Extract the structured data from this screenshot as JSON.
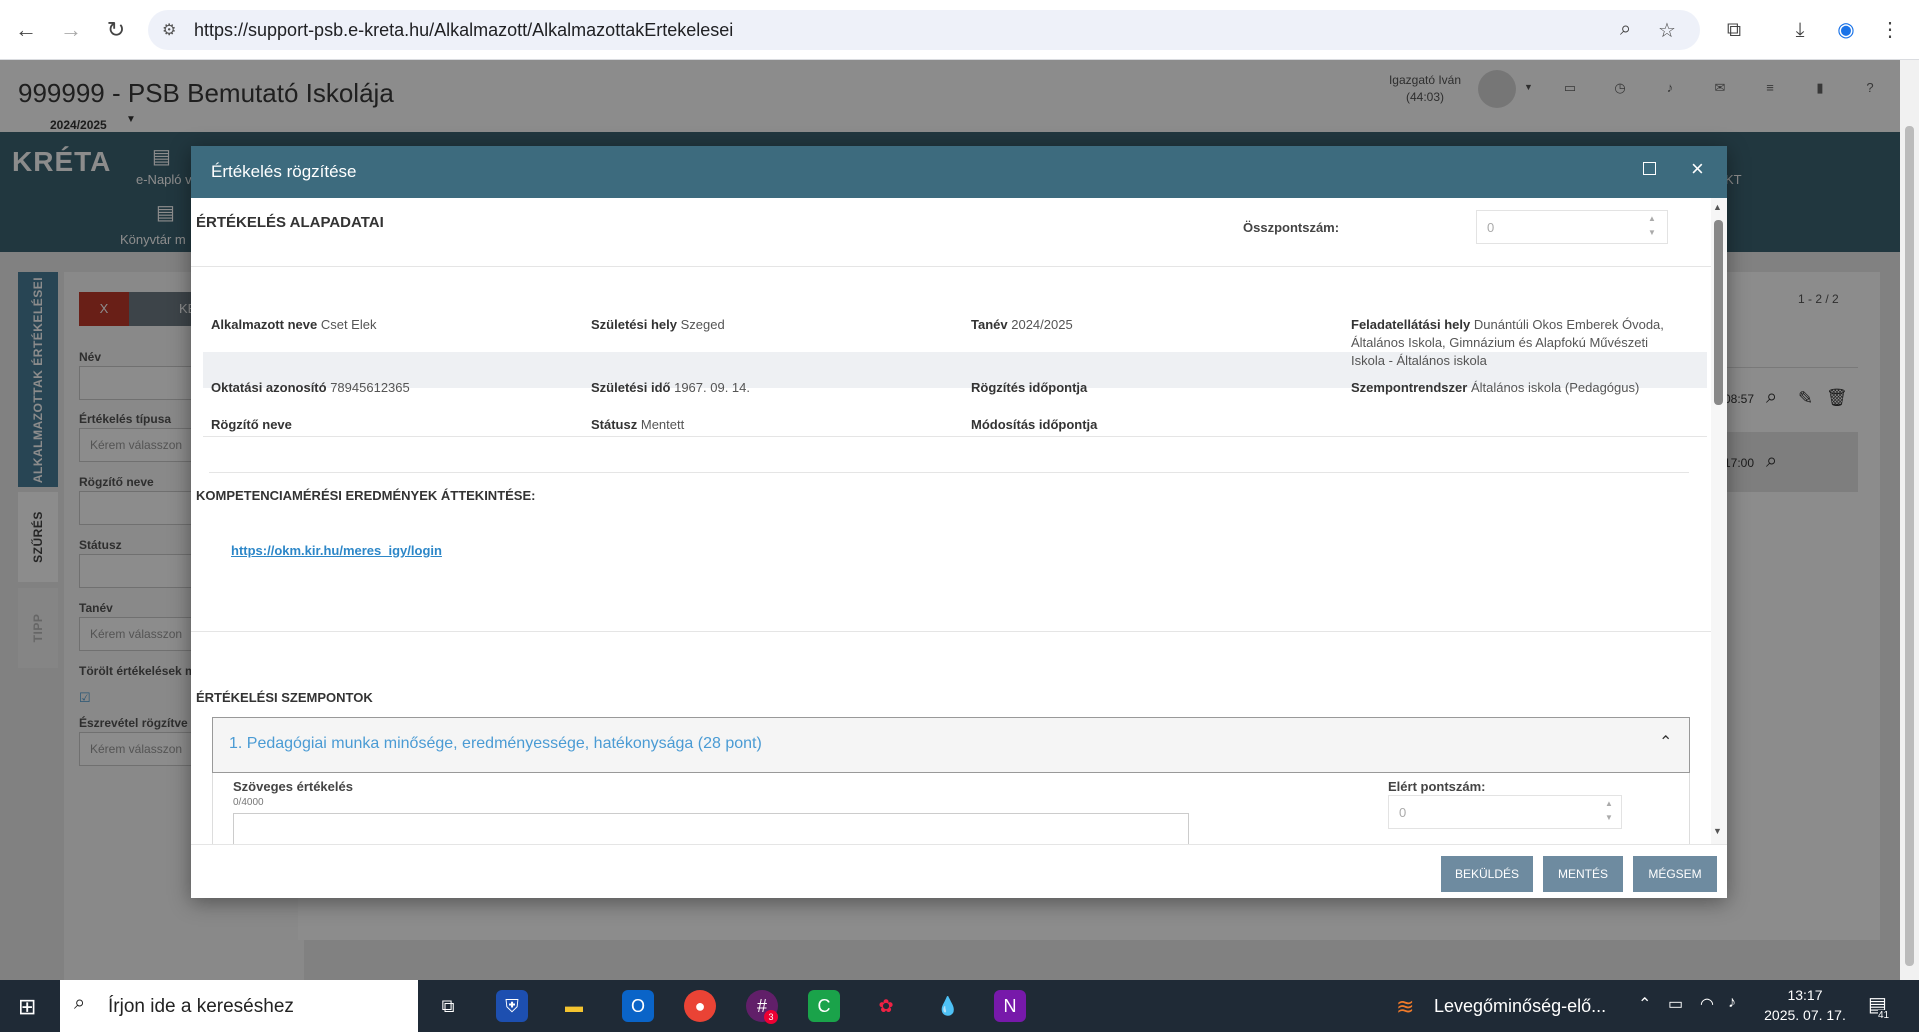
{
  "browser": {
    "url": "https://support-psb.e-kreta.hu/Alkalmazott/AlkalmazottakErtekelesei"
  },
  "header": {
    "school_title": "999999 - PSB Bemutató Iskolája",
    "school_year": "2024/2025",
    "user_name": "Igazgató Iván",
    "session_timer": "(44:03)"
  },
  "mainnav": {
    "logo": "KRÉTA",
    "items": [
      {
        "label": "e-Napló v"
      },
      {
        "label": "Könyvtár m"
      },
      {
        "label": "KT"
      }
    ]
  },
  "sidetabs": {
    "alkalmazottak": "ALKALMAZOTTAK ÉRTÉKELÉSEI",
    "szures": "SZŰRÉS",
    "tipp": "TIPP"
  },
  "filter": {
    "x_button": "X",
    "ke_button": "KE",
    "nev_label": "Név",
    "tipus_label": "Értékelés típusa",
    "tipus_placeholder": "Kérem válasszon",
    "rogzito_label": "Rögzítő neve",
    "statusz_label": "Státusz",
    "tanev_label": "Tanév",
    "tanev_placeholder": "Kérem válasszon",
    "torolt_label": "Törölt értékelések m",
    "eszrevetel_label": "Észrevétel rögzítve",
    "eszrevetel_placeholder": "Kérem válasszon"
  },
  "grid": {
    "pager": "1 - 2 / 2",
    "row1_time": "08:57",
    "row2_time": "17:00"
  },
  "modal": {
    "title": "Értékelés rögzítése",
    "section_basic": "ÉRTÉKELÉS ALAPADATAI",
    "total_points_label": "Összpontszám:",
    "total_points_value": "0",
    "fields": {
      "alkalmazott_label": "Alkalmazott neve",
      "alkalmazott_value": "Cset Elek",
      "szul_hely_label": "Születési hely",
      "szul_hely_value": "Szeged",
      "tanev_label": "Tanév",
      "tanev_value": "2024/2025",
      "feladat_label": "Feladatellátási hely",
      "feladat_value_1": "Dunántúli Okos Emberek Óvoda,",
      "feladat_value_2": "Általános Iskola, Gimnázium és Alapfokú Művészeti",
      "feladat_value_3": "Iskola - Általános iskola",
      "okt_azon_label": "Oktatási azonosító",
      "okt_azon_value": "78945612365",
      "szul_ido_label": "Születési idő",
      "szul_ido_value": "1967. 09. 14.",
      "rogz_idopont_label": "Rögzítés időpontja",
      "szempont_label": "Szempontrendszer",
      "szempont_value": "Általános iskola (Pedagógus)",
      "rogzito_label": "Rögzítő neve",
      "statusz_label": "Státusz",
      "statusz_value": "Mentett",
      "mod_idopont_label": "Módosítás időpontja"
    },
    "section_komp": "KOMPETENCIAMÉRÉSI EREDMÉNYEK ÁTTEKINTÉSE:",
    "komp_link": "https://okm.kir.hu/meres_igy/login",
    "section_szempontok": "ÉRTÉKELÉSI SZEMPONTOK",
    "criterion_1": "1. Pedagógiai munka minősége, eredményessége, hatékonysága (28 pont)",
    "text_eval_label": "Szöveges értékelés",
    "char_count": "0/4000",
    "points_label": "Elért pontszám:",
    "points_value": "0",
    "buttons": {
      "submit": "BEKÜLDÉS",
      "save": "MENTÉS",
      "cancel": "MÉGSEM"
    }
  },
  "taskbar": {
    "search_placeholder": "Írjon ide a kereséshez",
    "weather": "Levegőminőség-elő...",
    "time": "13:17",
    "date": "2025. 07. 17.",
    "notif_count": "41",
    "slack_badge": "3"
  },
  "colors": {
    "nav": "#3d6473",
    "modal_header": "#3d6b7e",
    "button": "#6e8ba0",
    "link": "#2d87c8",
    "accent_blue": "#4a9bd4"
  }
}
